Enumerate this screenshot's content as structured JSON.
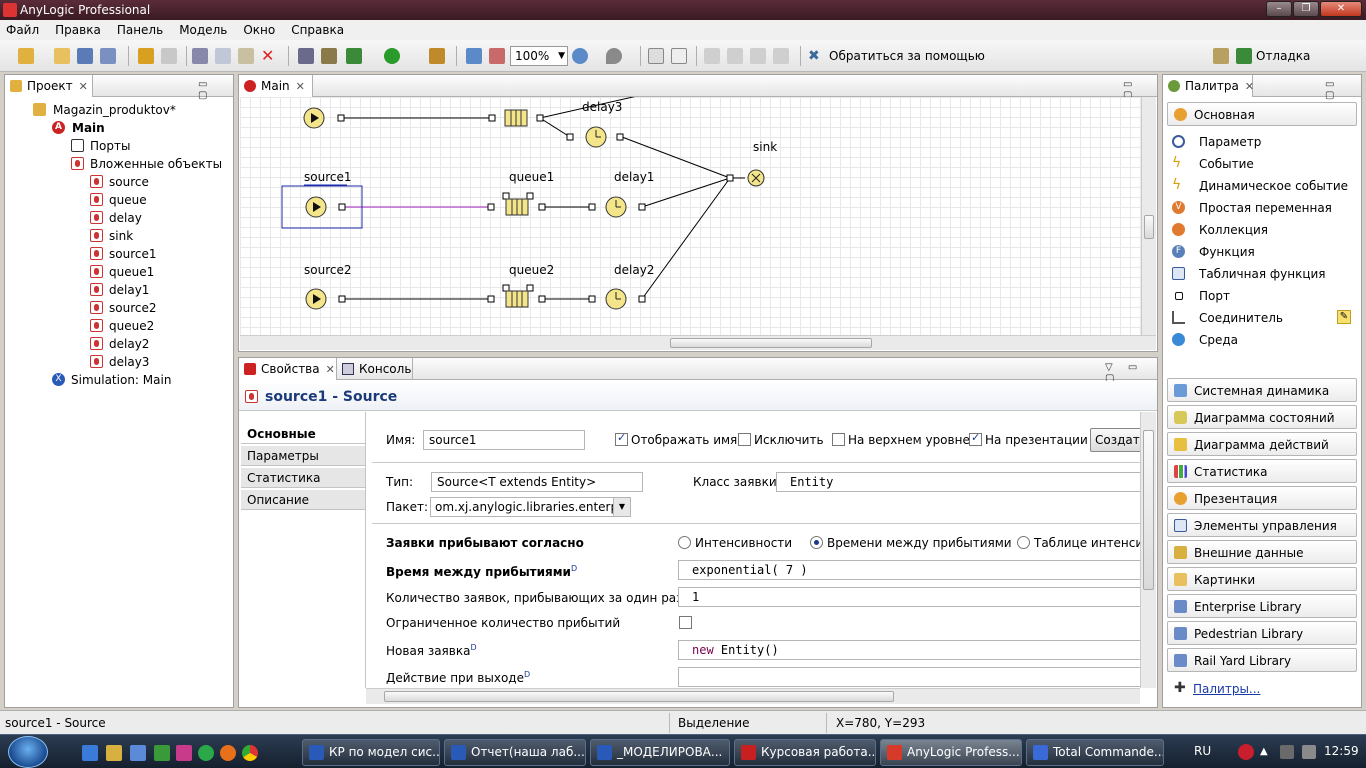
{
  "window": {
    "title": "AnyLogic Professional"
  },
  "menu": [
    "Файл",
    "Правка",
    "Панель",
    "Модель",
    "Окно",
    "Справка"
  ],
  "toolbar": {
    "zoom": "100%",
    "help_label": "Обратиться за помощью",
    "perspective_label": "Отладка"
  },
  "project": {
    "tab_label": "Проект",
    "root": "Magazin_produktov*",
    "main": "Main",
    "ports": "Порты",
    "embedded": "Вложенные объекты",
    "objects": [
      "source",
      "queue",
      "delay",
      "sink",
      "source1",
      "queue1",
      "delay1",
      "source2",
      "queue2",
      "delay2",
      "delay3"
    ],
    "simulation": "Simulation: Main"
  },
  "editor": {
    "tab_label": "Main",
    "labels": {
      "delay3": "delay3",
      "sink": "sink",
      "source1": "source1",
      "queue1": "queue1",
      "delay1": "delay1",
      "source2": "source2",
      "queue2": "queue2",
      "delay2": "delay2"
    }
  },
  "properties": {
    "tab_label": "Свойства",
    "console_label": "Консоль",
    "header": "source1 - Source",
    "side_tabs": [
      "Основные",
      "Параметры",
      "Статистика",
      "Описание"
    ],
    "name_label": "Имя:",
    "name_value": "source1",
    "show_name": "Отображать имя",
    "exclude": "Исключить",
    "top_level": "На верхнем уровне",
    "on_presentation": "На презентации",
    "create_btn": "Создать",
    "type_label": "Тип:",
    "type_value": "Source<T extends Entity>",
    "entity_class_label": "Класс заявки:",
    "entity_class_value": "Entity",
    "package_label": "Пакет:",
    "package_value": "om.xj.anylogic.libraries.enterprise",
    "arrivals_label": "Заявки прибывают согласно",
    "arr_opt1": "Интенсивности",
    "arr_opt2": "Времени между прибытиями",
    "arr_opt3": "Таблице интенсивн",
    "interarrival_label": "Время между прибытиями",
    "interarrival_value": "exponential( 7 )",
    "per_arrival_label": "Количество заявок, прибывающих за один раз",
    "per_arrival_value": "1",
    "limited_label": "Ограниченное количество прибытий",
    "new_entity_label": "Новая заявка",
    "new_entity_kw": "new",
    "new_entity_value": " Entity()",
    "on_exit_label": "Действие при выходе",
    "d_mark": "D"
  },
  "palette": {
    "tab_label": "Палитра",
    "section": "Основная",
    "items": [
      "Параметр",
      "Событие",
      "Динамическое событие",
      "Простая переменная",
      "Коллекция",
      "Функция",
      "Табличная функция",
      "Порт",
      "Соединитель",
      "Среда"
    ],
    "libraries": [
      "Системная динамика",
      "Диаграмма состояний",
      "Диаграмма действий",
      "Статистика",
      "Презентация",
      "Элементы управления",
      "Внешние данные",
      "Картинки",
      "Enterprise Library",
      "Pedestrian Library",
      "Rail Yard Library"
    ],
    "more_link": "Палитры..."
  },
  "status": {
    "left": "source1 - Source",
    "mode": "Выделение",
    "coords": "X=780, Y=293"
  },
  "taskbar": {
    "items": [
      "КР по модел сис...",
      "Отчет(наша лаб...",
      "_МОДЕЛИРОВА...",
      "Курсовая работа...",
      "AnyLogic Profess...",
      "Total Commande..."
    ],
    "lang": "RU",
    "clock": "12:59"
  }
}
